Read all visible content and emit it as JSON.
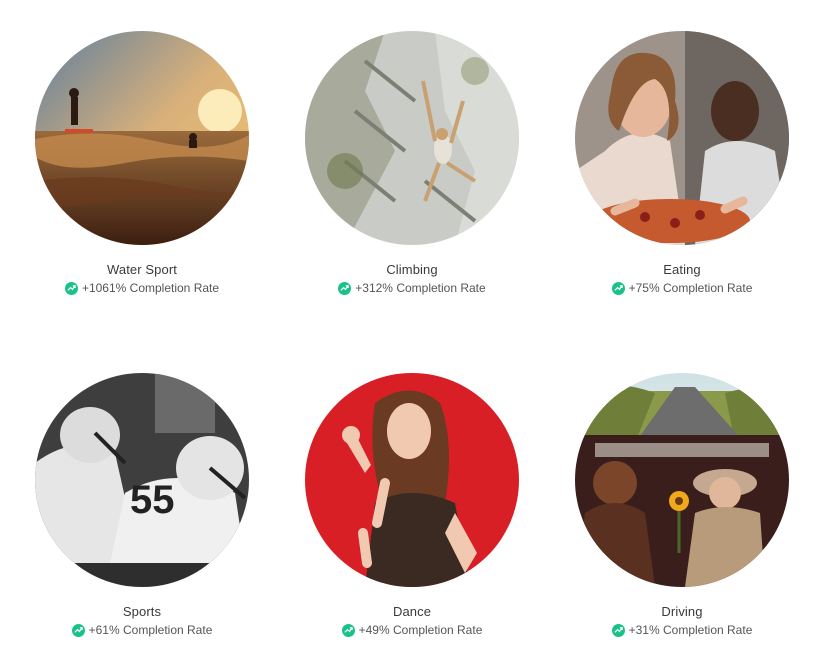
{
  "accent_color": "#19c28a",
  "stat_icon": "trending-up-icon",
  "cards": [
    {
      "title": "Water Sport",
      "stat": "+1061% Completion Rate"
    },
    {
      "title": "Climbing",
      "stat": "+312% Completion Rate"
    },
    {
      "title": "Eating",
      "stat": "+75% Completion Rate"
    },
    {
      "title": "Sports",
      "stat": "+61% Completion Rate"
    },
    {
      "title": "Dance",
      "stat": "+49% Completion Rate"
    },
    {
      "title": "Driving",
      "stat": "+31% Completion Rate"
    }
  ]
}
